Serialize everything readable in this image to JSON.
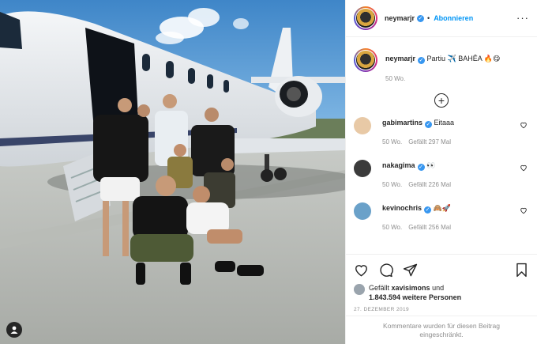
{
  "post": {
    "username": "neymarjr",
    "follow_label": "Abonnieren",
    "dot_separator": "•",
    "more_icon": "more-dots-icon"
  },
  "caption": {
    "username": "neymarjr",
    "text": "Partiu ✈️ BAHÊA 🔥😋",
    "time": "50 Wo."
  },
  "comments": [
    {
      "username": "gabimartins",
      "text": "Eitaaa",
      "time": "50 Wo.",
      "likes": "Gefällt 297 Mal",
      "avatar_color": "#e8c9a6"
    },
    {
      "username": "nakagima",
      "text": "👀",
      "time": "50 Wo.",
      "likes": "Gefällt 226 Mal",
      "avatar_color": "#3b3b3b"
    },
    {
      "username": "kevinochris",
      "text": "🙈🚀",
      "time": "50 Wo.",
      "likes": "Gefällt 256 Mal",
      "avatar_color": "#6aa1c9"
    }
  ],
  "likes": {
    "prefix": "Gefällt",
    "user": "xavisimons",
    "connector": "und",
    "count": "1.843.594 weitere Personen"
  },
  "date": "27. Dezember 2019",
  "restricted_text": "Kommentare wurden für diesen Beitrag eingeschränkt.",
  "colors": {
    "accent": "#0095f6",
    "verified": "#3897f0",
    "muted": "#8e8e8e"
  }
}
